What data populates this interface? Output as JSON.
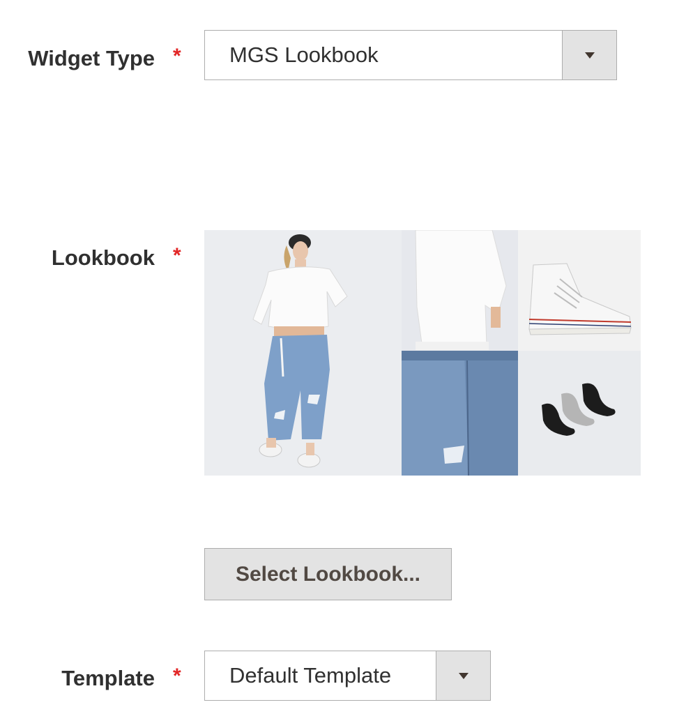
{
  "form": {
    "widget_type": {
      "label": "Widget Type",
      "required_mark": "*",
      "selected": "MGS Lookbook"
    },
    "lookbook": {
      "label": "Lookbook",
      "required_mark": "*",
      "select_button": "Select Lookbook..."
    },
    "template": {
      "label": "Template",
      "required_mark": "*",
      "selected": "Default Template"
    }
  },
  "colors": {
    "required": "#e22626",
    "button_bg": "#e3e3e3",
    "border": "#adadad",
    "text": "#303030"
  },
  "icons": {
    "dropdown": "chevron-down-icon"
  }
}
